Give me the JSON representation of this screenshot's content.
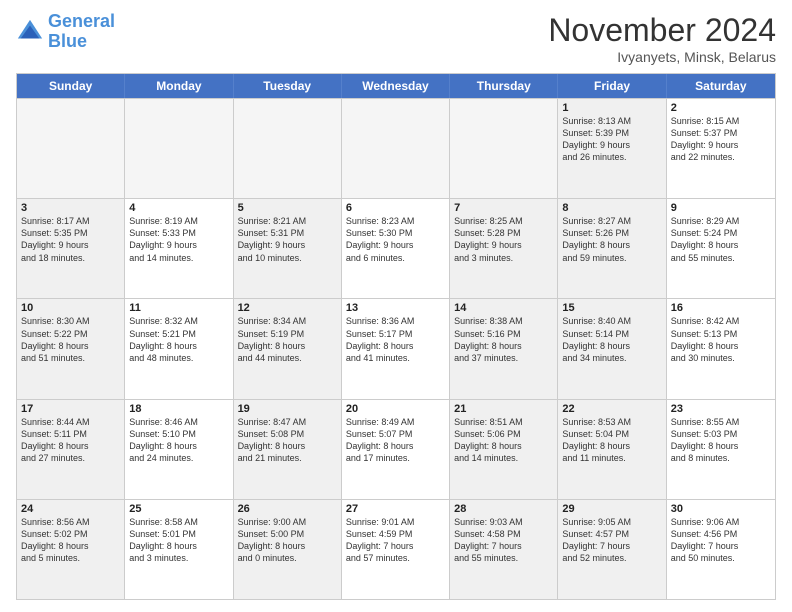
{
  "logo": {
    "line1": "General",
    "line2": "Blue"
  },
  "title": "November 2024",
  "subtitle": "Ivyanyets, Minsk, Belarus",
  "days_header": [
    "Sunday",
    "Monday",
    "Tuesday",
    "Wednesday",
    "Thursday",
    "Friday",
    "Saturday"
  ],
  "weeks": [
    [
      {
        "day": "",
        "info": "",
        "empty": true
      },
      {
        "day": "",
        "info": "",
        "empty": true
      },
      {
        "day": "",
        "info": "",
        "empty": true
      },
      {
        "day": "",
        "info": "",
        "empty": true
      },
      {
        "day": "",
        "info": "",
        "empty": true
      },
      {
        "day": "1",
        "info": "Sunrise: 8:13 AM\nSunset: 5:39 PM\nDaylight: 9 hours\nand 26 minutes.",
        "shaded": true
      },
      {
        "day": "2",
        "info": "Sunrise: 8:15 AM\nSunset: 5:37 PM\nDaylight: 9 hours\nand 22 minutes."
      }
    ],
    [
      {
        "day": "3",
        "info": "Sunrise: 8:17 AM\nSunset: 5:35 PM\nDaylight: 9 hours\nand 18 minutes.",
        "shaded": true
      },
      {
        "day": "4",
        "info": "Sunrise: 8:19 AM\nSunset: 5:33 PM\nDaylight: 9 hours\nand 14 minutes."
      },
      {
        "day": "5",
        "info": "Sunrise: 8:21 AM\nSunset: 5:31 PM\nDaylight: 9 hours\nand 10 minutes.",
        "shaded": true
      },
      {
        "day": "6",
        "info": "Sunrise: 8:23 AM\nSunset: 5:30 PM\nDaylight: 9 hours\nand 6 minutes."
      },
      {
        "day": "7",
        "info": "Sunrise: 8:25 AM\nSunset: 5:28 PM\nDaylight: 9 hours\nand 3 minutes.",
        "shaded": true
      },
      {
        "day": "8",
        "info": "Sunrise: 8:27 AM\nSunset: 5:26 PM\nDaylight: 8 hours\nand 59 minutes.",
        "shaded": true
      },
      {
        "day": "9",
        "info": "Sunrise: 8:29 AM\nSunset: 5:24 PM\nDaylight: 8 hours\nand 55 minutes."
      }
    ],
    [
      {
        "day": "10",
        "info": "Sunrise: 8:30 AM\nSunset: 5:22 PM\nDaylight: 8 hours\nand 51 minutes.",
        "shaded": true
      },
      {
        "day": "11",
        "info": "Sunrise: 8:32 AM\nSunset: 5:21 PM\nDaylight: 8 hours\nand 48 minutes."
      },
      {
        "day": "12",
        "info": "Sunrise: 8:34 AM\nSunset: 5:19 PM\nDaylight: 8 hours\nand 44 minutes.",
        "shaded": true
      },
      {
        "day": "13",
        "info": "Sunrise: 8:36 AM\nSunset: 5:17 PM\nDaylight: 8 hours\nand 41 minutes."
      },
      {
        "day": "14",
        "info": "Sunrise: 8:38 AM\nSunset: 5:16 PM\nDaylight: 8 hours\nand 37 minutes.",
        "shaded": true
      },
      {
        "day": "15",
        "info": "Sunrise: 8:40 AM\nSunset: 5:14 PM\nDaylight: 8 hours\nand 34 minutes.",
        "shaded": true
      },
      {
        "day": "16",
        "info": "Sunrise: 8:42 AM\nSunset: 5:13 PM\nDaylight: 8 hours\nand 30 minutes."
      }
    ],
    [
      {
        "day": "17",
        "info": "Sunrise: 8:44 AM\nSunset: 5:11 PM\nDaylight: 8 hours\nand 27 minutes.",
        "shaded": true
      },
      {
        "day": "18",
        "info": "Sunrise: 8:46 AM\nSunset: 5:10 PM\nDaylight: 8 hours\nand 24 minutes."
      },
      {
        "day": "19",
        "info": "Sunrise: 8:47 AM\nSunset: 5:08 PM\nDaylight: 8 hours\nand 21 minutes.",
        "shaded": true
      },
      {
        "day": "20",
        "info": "Sunrise: 8:49 AM\nSunset: 5:07 PM\nDaylight: 8 hours\nand 17 minutes."
      },
      {
        "day": "21",
        "info": "Sunrise: 8:51 AM\nSunset: 5:06 PM\nDaylight: 8 hours\nand 14 minutes.",
        "shaded": true
      },
      {
        "day": "22",
        "info": "Sunrise: 8:53 AM\nSunset: 5:04 PM\nDaylight: 8 hours\nand 11 minutes.",
        "shaded": true
      },
      {
        "day": "23",
        "info": "Sunrise: 8:55 AM\nSunset: 5:03 PM\nDaylight: 8 hours\nand 8 minutes."
      }
    ],
    [
      {
        "day": "24",
        "info": "Sunrise: 8:56 AM\nSunset: 5:02 PM\nDaylight: 8 hours\nand 5 minutes.",
        "shaded": true
      },
      {
        "day": "25",
        "info": "Sunrise: 8:58 AM\nSunset: 5:01 PM\nDaylight: 8 hours\nand 3 minutes."
      },
      {
        "day": "26",
        "info": "Sunrise: 9:00 AM\nSunset: 5:00 PM\nDaylight: 8 hours\nand 0 minutes.",
        "shaded": true
      },
      {
        "day": "27",
        "info": "Sunrise: 9:01 AM\nSunset: 4:59 PM\nDaylight: 7 hours\nand 57 minutes."
      },
      {
        "day": "28",
        "info": "Sunrise: 9:03 AM\nSunset: 4:58 PM\nDaylight: 7 hours\nand 55 minutes.",
        "shaded": true
      },
      {
        "day": "29",
        "info": "Sunrise: 9:05 AM\nSunset: 4:57 PM\nDaylight: 7 hours\nand 52 minutes.",
        "shaded": true
      },
      {
        "day": "30",
        "info": "Sunrise: 9:06 AM\nSunset: 4:56 PM\nDaylight: 7 hours\nand 50 minutes."
      }
    ]
  ]
}
